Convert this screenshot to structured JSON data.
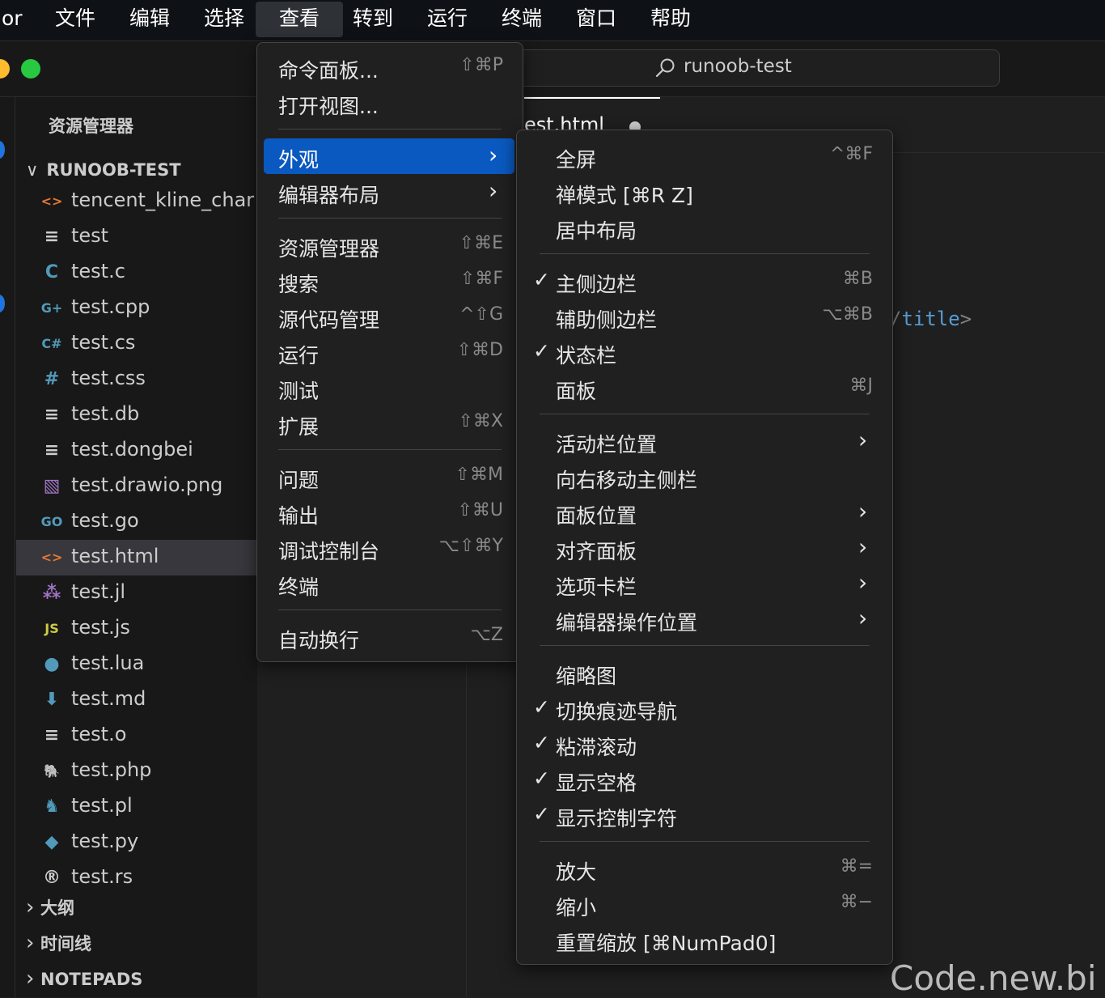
{
  "menubar": {
    "app": "or",
    "items": [
      "文件",
      "编辑",
      "选择",
      "查看",
      "转到",
      "运行",
      "终端",
      "窗口",
      "帮助"
    ]
  },
  "titlebar": {
    "search_label": "runoob-test"
  },
  "sidebar": {
    "title": "资源管理器",
    "root": "RUNOOB-TEST",
    "files": [
      {
        "name": "tencent_kline_char",
        "icon": "<>",
        "color": "#e37933"
      },
      {
        "name": "test",
        "icon": "≡",
        "color": "#cccccc"
      },
      {
        "name": "test.c",
        "icon": "C",
        "color": "#519aba"
      },
      {
        "name": "test.cpp",
        "icon": "G+",
        "color": "#519aba"
      },
      {
        "name": "test.cs",
        "icon": "C#",
        "color": "#519aba"
      },
      {
        "name": "test.css",
        "icon": "#",
        "color": "#519aba"
      },
      {
        "name": "test.db",
        "icon": "≡",
        "color": "#cccccc"
      },
      {
        "name": "test.dongbei",
        "icon": "≡",
        "color": "#cccccc"
      },
      {
        "name": "test.drawio.png",
        "icon": "▧",
        "color": "#a074c4"
      },
      {
        "name": "test.go",
        "icon": "GO",
        "color": "#519aba"
      },
      {
        "name": "test.html",
        "icon": "<>",
        "color": "#e37933"
      },
      {
        "name": "test.jl",
        "icon": "⁂",
        "color": "#a074c4"
      },
      {
        "name": "test.js",
        "icon": "JS",
        "color": "#cbcb41"
      },
      {
        "name": "test.lua",
        "icon": "●",
        "color": "#519aba"
      },
      {
        "name": "test.md",
        "icon": "⬇",
        "color": "#519aba"
      },
      {
        "name": "test.o",
        "icon": "≡",
        "color": "#cccccc"
      },
      {
        "name": "test.php",
        "icon": "🐘",
        "color": "#a074c4"
      },
      {
        "name": "test.pl",
        "icon": "♞",
        "color": "#519aba"
      },
      {
        "name": "test.py",
        "icon": "◆",
        "color": "#519aba"
      },
      {
        "name": "test.rs",
        "icon": "®",
        "color": "#cccccc"
      }
    ],
    "sections": [
      "大纲",
      "时间线",
      "NOTEPADS"
    ]
  },
  "editor": {
    "tab_label": "est.html",
    "code_tag": "title",
    "code_tag_color": "#569cd6",
    "bracket_color": "#808080"
  },
  "view_menu": {
    "items": [
      {
        "label": "命令面板...",
        "shortcut": "⇧⌘P"
      },
      {
        "label": "打开视图...",
        "shortcut": ""
      },
      {
        "sep": true
      },
      {
        "label": "外观",
        "submenu": true,
        "highlighted": true
      },
      {
        "label": "编辑器布局",
        "submenu": true
      },
      {
        "sep": true
      },
      {
        "label": "资源管理器",
        "shortcut": "⇧⌘E"
      },
      {
        "label": "搜索",
        "shortcut": "⇧⌘F"
      },
      {
        "label": "源代码管理",
        "shortcut": "^⇧G"
      },
      {
        "label": "运行",
        "shortcut": "⇧⌘D"
      },
      {
        "label": "测试",
        "shortcut": ""
      },
      {
        "label": "扩展",
        "shortcut": "⇧⌘X"
      },
      {
        "sep": true
      },
      {
        "label": "问题",
        "shortcut": "⇧⌘M"
      },
      {
        "label": "输出",
        "shortcut": "⇧⌘U"
      },
      {
        "label": "调试控制台",
        "shortcut": "⌥⇧⌘Y"
      },
      {
        "label": "终端",
        "shortcut": ""
      },
      {
        "sep": true
      },
      {
        "label": "自动换行",
        "shortcut": "⌥Z"
      }
    ]
  },
  "appearance_menu": {
    "items": [
      {
        "label": "全屏",
        "shortcut": "^⌘F"
      },
      {
        "label": "禅模式 [⌘R Z]",
        "shortcut": ""
      },
      {
        "label": "居中布局",
        "shortcut": ""
      },
      {
        "sep": true
      },
      {
        "label": "主侧边栏",
        "shortcut": "⌘B",
        "checked": true
      },
      {
        "label": "辅助侧边栏",
        "shortcut": "⌥⌘B"
      },
      {
        "label": "状态栏",
        "shortcut": "",
        "checked": true
      },
      {
        "label": "面板",
        "shortcut": "⌘J"
      },
      {
        "sep": true
      },
      {
        "label": "活动栏位置",
        "submenu": true
      },
      {
        "label": "向右移动主侧栏",
        "shortcut": ""
      },
      {
        "label": "面板位置",
        "submenu": true
      },
      {
        "label": "对齐面板",
        "submenu": true
      },
      {
        "label": "选项卡栏",
        "submenu": true
      },
      {
        "label": "编辑器操作位置",
        "submenu": true
      },
      {
        "sep": true
      },
      {
        "label": "缩略图",
        "shortcut": ""
      },
      {
        "label": "切换痕迹导航",
        "shortcut": "",
        "checked": true
      },
      {
        "label": "粘滞滚动",
        "shortcut": "",
        "checked": true
      },
      {
        "label": "显示空格",
        "shortcut": "",
        "checked": true
      },
      {
        "label": "显示控制字符",
        "shortcut": "",
        "checked": true
      },
      {
        "sep": true
      },
      {
        "label": "放大",
        "shortcut": "⌘="
      },
      {
        "label": "缩小",
        "shortcut": "⌘−"
      },
      {
        "label": "重置缩放 [⌘NumPad0]",
        "shortcut": ""
      }
    ]
  },
  "watermark": "Code.new.bi",
  "colors": {
    "accent": "#0a59c0",
    "traffic_yellow": "#febc2e",
    "traffic_green": "#28c840"
  }
}
